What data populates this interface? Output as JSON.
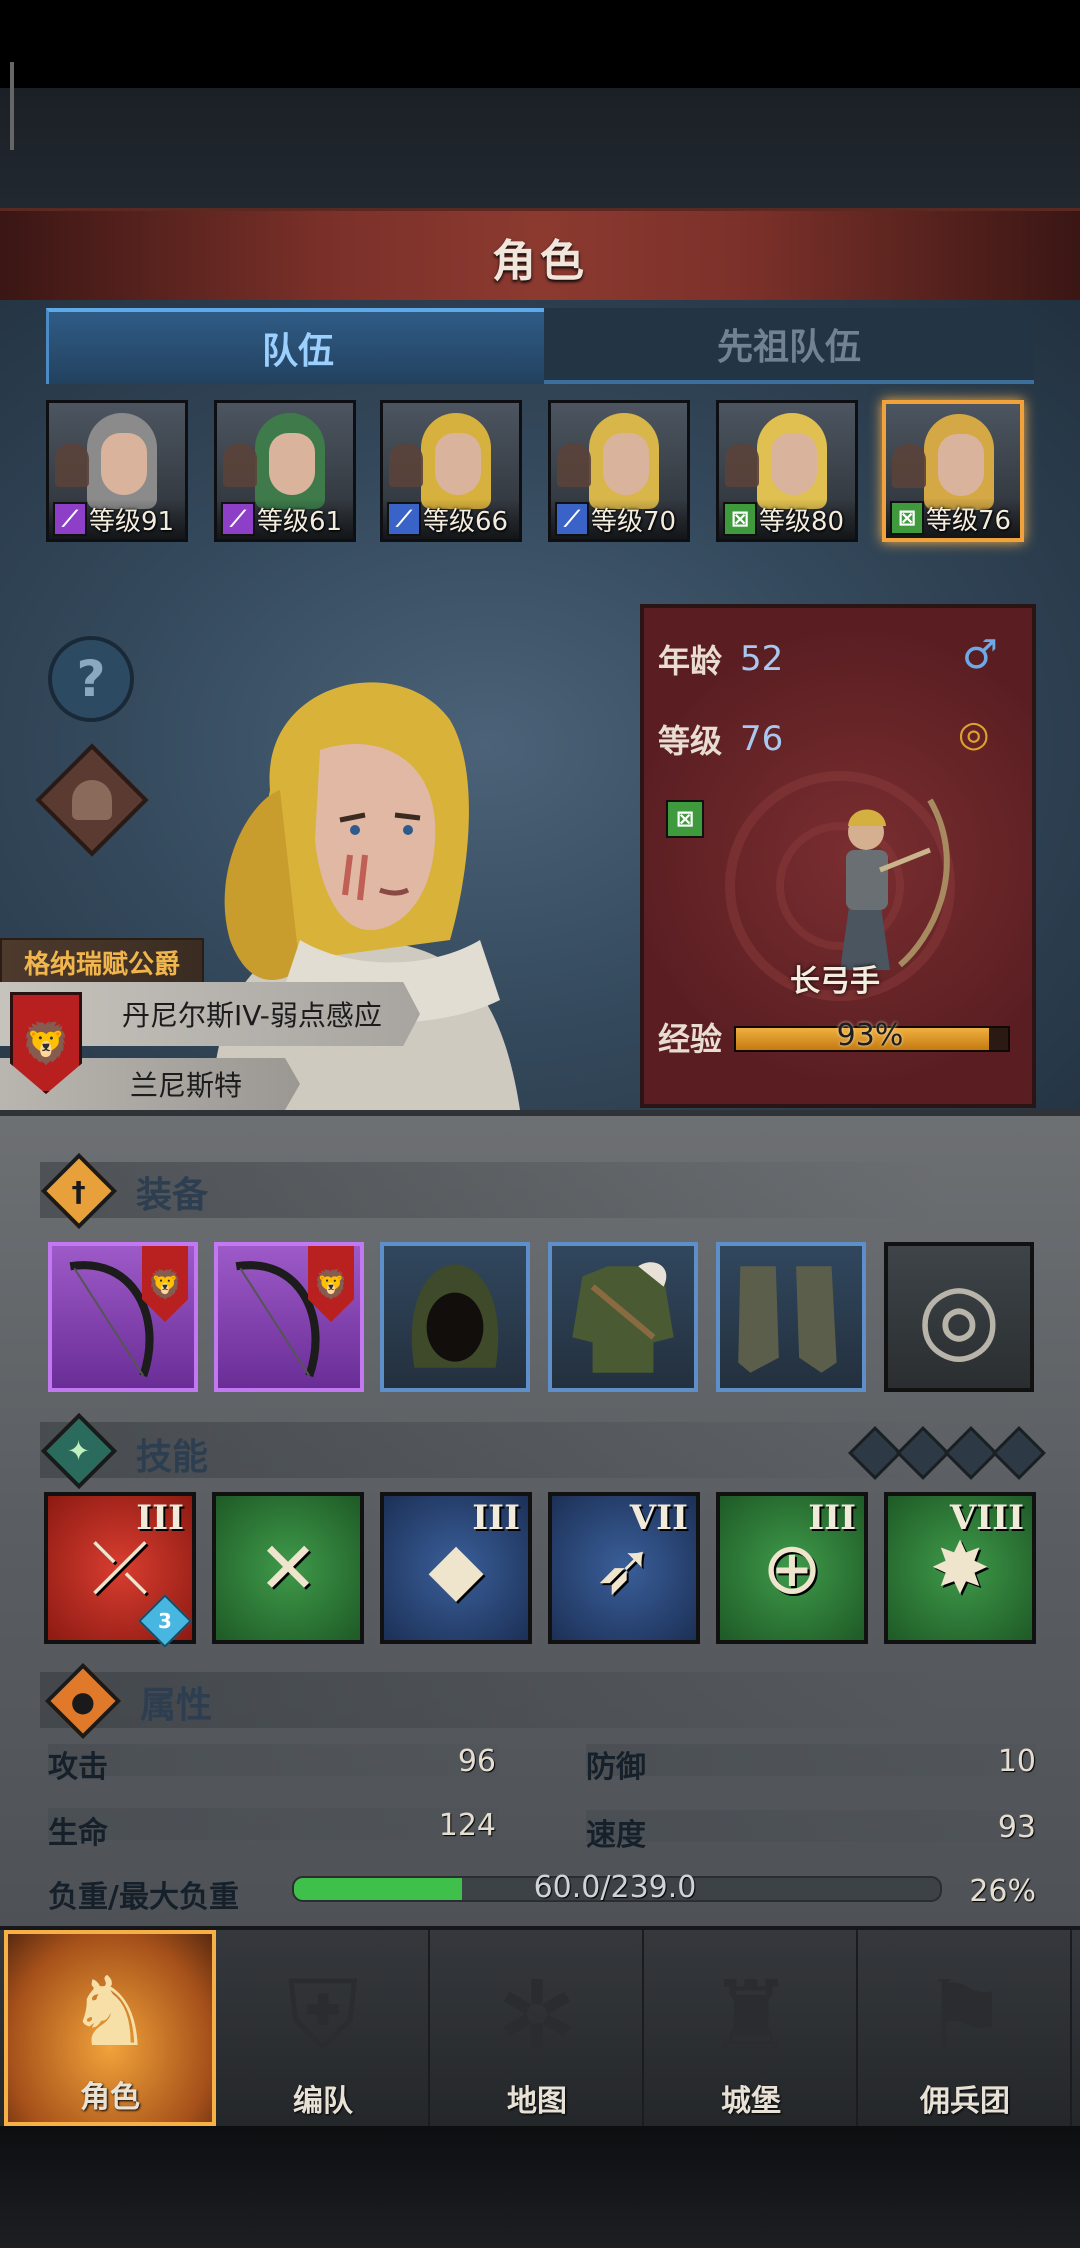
{
  "header": {
    "title": "角色"
  },
  "tabs": [
    {
      "label": "队伍",
      "active": true
    },
    {
      "label": "先祖队伍",
      "active": false
    }
  ],
  "party": [
    {
      "class_icon": "staff-icon",
      "level": "等级91",
      "hair": "#8b8b8b",
      "selected": false
    },
    {
      "class_icon": "staff-icon",
      "level": "等级61",
      "hair": "#3e7a4a",
      "selected": false
    },
    {
      "class_icon": "sword-icon",
      "level": "等级66",
      "hair": "#d7b13e",
      "selected": false
    },
    {
      "class_icon": "sword-icon",
      "level": "等级70",
      "hair": "#d8b64a",
      "selected": false
    },
    {
      "class_icon": "bow-icon",
      "level": "等级80",
      "hair": "#e0c050",
      "selected": false
    },
    {
      "class_icon": "bow-icon",
      "level": "等级76",
      "hair": "#d4a844",
      "selected": true
    }
  ],
  "hero": {
    "title": "格纳瑞赋公爵",
    "hero_name": "丹尼尔斯IV-弱点感应",
    "name": "兰尼斯特"
  },
  "info": {
    "age_label": "年龄",
    "age": "52",
    "level_label": "等级",
    "level": "76",
    "class_name": "长弓手",
    "xp_label": "经验",
    "xp_text": "93%",
    "xp_fraction": 0.93
  },
  "equipment": {
    "title": "装备",
    "items": [
      {
        "name": "longbow-icon",
        "rarity": "epic",
        "glyph": "",
        "has_shield": true
      },
      {
        "name": "longbow-icon",
        "rarity": "epic",
        "glyph": "",
        "has_shield": true
      },
      {
        "name": "hood-icon",
        "rarity": "rare",
        "glyph": "",
        "has_shield": false
      },
      {
        "name": "tunic-icon",
        "rarity": "rare",
        "glyph": "",
        "has_shield": false
      },
      {
        "name": "boots-icon",
        "rarity": "rare",
        "glyph": "",
        "has_shield": false
      },
      {
        "name": "ring-icon",
        "rarity": "common",
        "glyph": "◎",
        "has_shield": false
      }
    ],
    "shield_glyph": "🦁"
  },
  "skills": {
    "title": "技能",
    "gem_count": 4,
    "items": [
      {
        "name": "shot-icon",
        "color": "red",
        "rank": "III",
        "badge": "3",
        "glyph": "⤫"
      },
      {
        "name": "bow-strike-icon",
        "color": "green",
        "rank": "",
        "badge": "",
        "glyph": "✕"
      },
      {
        "name": "crystal-shot-icon",
        "color": "blue",
        "rank": "III",
        "badge": "",
        "glyph": "◆"
      },
      {
        "name": "dash-icon",
        "color": "blue",
        "rank": "VII",
        "badge": "",
        "glyph": "➶"
      },
      {
        "name": "target-icon",
        "color": "green",
        "rank": "III",
        "badge": "",
        "glyph": "⊕"
      },
      {
        "name": "burst-icon",
        "color": "green",
        "rank": "VIII",
        "badge": "",
        "glyph": "✸"
      }
    ]
  },
  "attributes": {
    "title": "属性",
    "attack_label": "攻击",
    "attack": "96",
    "defense_label": "防御",
    "defense": "10",
    "hp_label": "生命",
    "hp": "124",
    "speed_label": "速度",
    "speed": "93",
    "load_label": "负重/最大负重",
    "load_text": "60.0/239.0",
    "load_percent": "26%",
    "load_fraction": 0.26
  },
  "nav": [
    {
      "label": "角色",
      "active": true,
      "glyph": "♞"
    },
    {
      "label": "编队",
      "active": false,
      "glyph": "⛨"
    },
    {
      "label": "地图",
      "active": false,
      "glyph": "✲"
    },
    {
      "label": "城堡",
      "active": false,
      "glyph": "♜"
    },
    {
      "label": "佣兵团",
      "active": false,
      "glyph": "⚑"
    }
  ],
  "colors": {
    "accent_orange": "#f2a23a",
    "tab_blue": "#5fa9e6",
    "panel_red": "#7a2e30"
  }
}
